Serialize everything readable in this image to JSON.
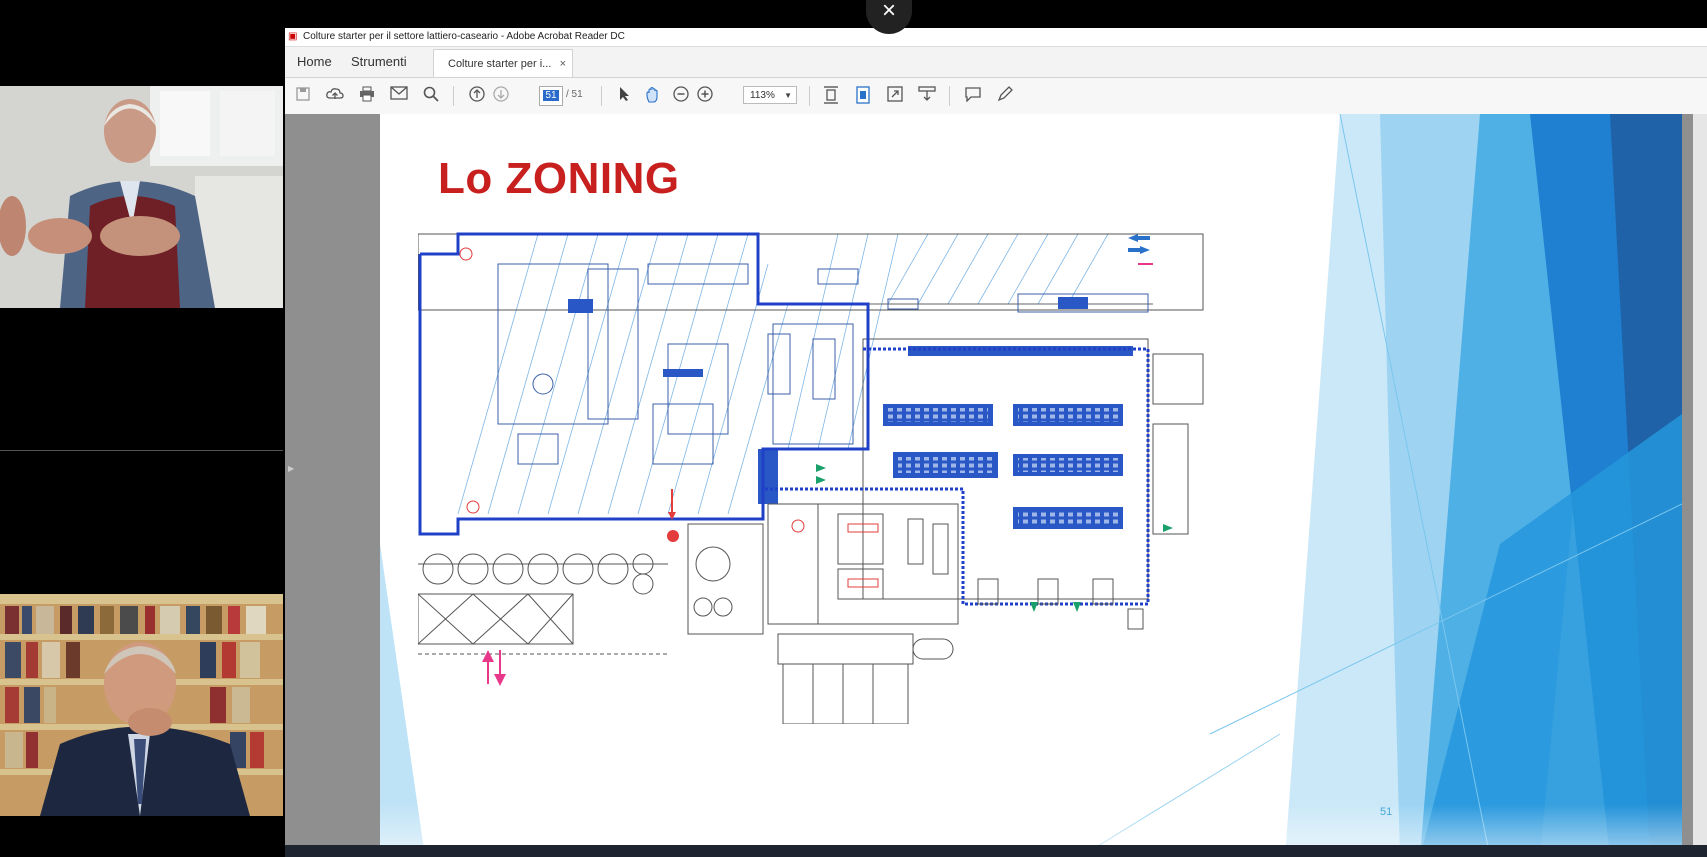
{
  "window": {
    "title": "Colture starter per il settore lattiero-caseario - Adobe Acrobat Reader DC",
    "close_glyph": "×"
  },
  "menu": {
    "home": "Home",
    "tools": "Strumenti",
    "doc_tab": "Colture starter per i...",
    "tab_close": "×"
  },
  "toolbar": {
    "page_current": "51",
    "page_total": "/ 51",
    "zoom": "113%"
  },
  "slide": {
    "title": "Lo ZONING",
    "page_number": "51"
  },
  "colors": {
    "title_red": "#c8201f",
    "plan_blue": "#2a57c6",
    "accent_blue": "#2a72c9",
    "slide_deco_blue": "#1f7fd0"
  },
  "icons": {
    "save": "save-icon",
    "upload": "cloud-upload-icon",
    "print": "print-icon",
    "email": "email-icon",
    "search": "search-icon",
    "prev": "page-up-icon",
    "next": "page-down-icon",
    "select": "cursor-icon",
    "hand": "hand-icon",
    "zoom_out": "zoom-out-icon",
    "zoom_in": "zoom-in-icon"
  }
}
